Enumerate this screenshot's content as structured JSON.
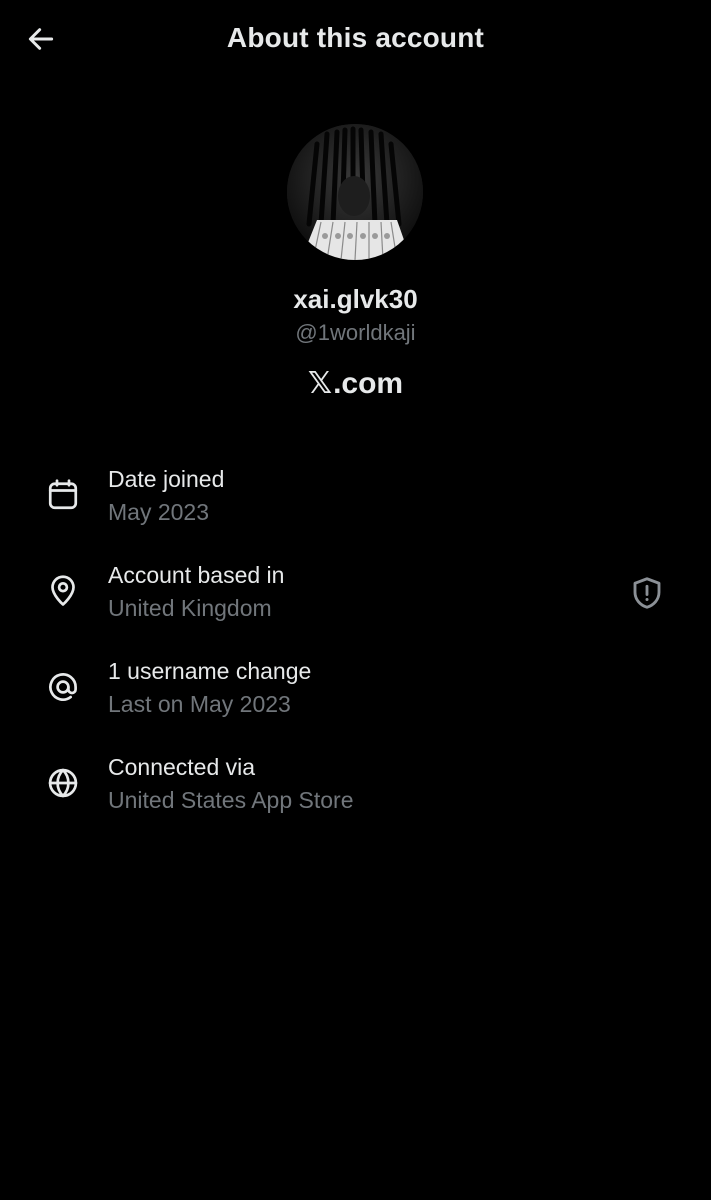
{
  "header": {
    "title": "About this account",
    "back_icon": "arrow-left-icon"
  },
  "profile": {
    "display_name": "xai.glvk30",
    "handle": "@1worldkaji",
    "avatar_icon": "avatar-photo"
  },
  "site": {
    "x_glyph": "𝕏",
    "label": ".com"
  },
  "rows": [
    {
      "icon": "calendar-icon",
      "label": "Date joined",
      "value": "May 2023"
    },
    {
      "icon": "location-pin-icon",
      "label": "Account based in",
      "value": "United Kingdom"
    },
    {
      "icon": "at-sign-icon",
      "label": "1 username change",
      "value": "Last on May 2023"
    },
    {
      "icon": "globe-icon",
      "label": "Connected via",
      "value": "United States App Store"
    }
  ],
  "badges": {
    "location_shield_icon": "shield-alert-icon"
  },
  "colors": {
    "background": "#000000",
    "primary_text": "#e7e9ea",
    "secondary_text": "#71767b"
  }
}
